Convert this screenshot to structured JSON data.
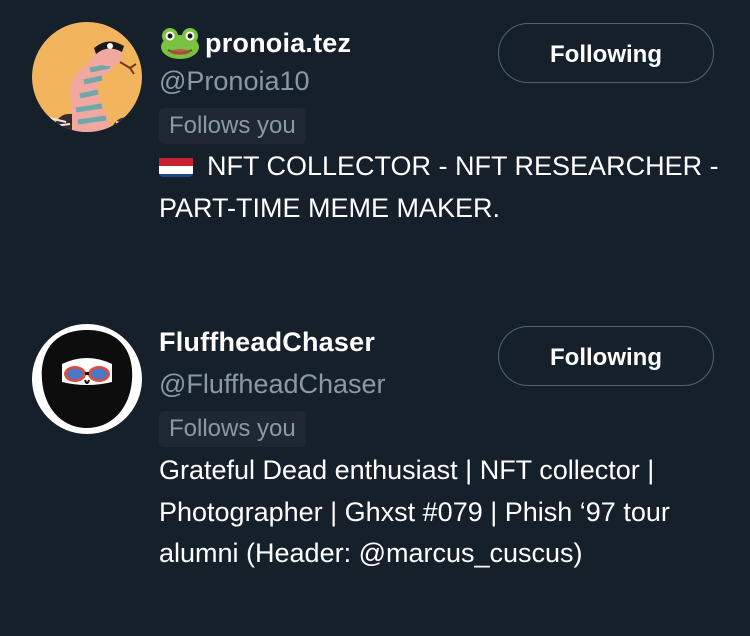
{
  "users": [
    {
      "avatar_icon": "snake-avatar-icon",
      "name_emoji_icon": "frog-icon",
      "display_name": "pronoia.tez",
      "handle": "@Pronoia10",
      "follows_you": "Follows you",
      "button_label": "Following",
      "bio_flag_icon": "netherlands-flag-icon",
      "bio": "NFT COLLECTOR - NFT RESEARCHER - PART-TIME MEME MAKER."
    },
    {
      "avatar_icon": "bearded-face-avatar-icon",
      "display_name": "FluffheadChaser",
      "handle": "@FluffheadChaser",
      "follows_you": "Follows you",
      "button_label": "Following",
      "bio": "Grateful Dead enthusiast | NFT collector | Photographer | Ghxst #079 | Phish ‘97 tour alumni (Header: @marcus_cuscus)"
    }
  ],
  "colors": {
    "background": "#15202b",
    "secondary_text": "#8b98a5",
    "badge_background": "#1e2732",
    "button_border": "#536471"
  }
}
